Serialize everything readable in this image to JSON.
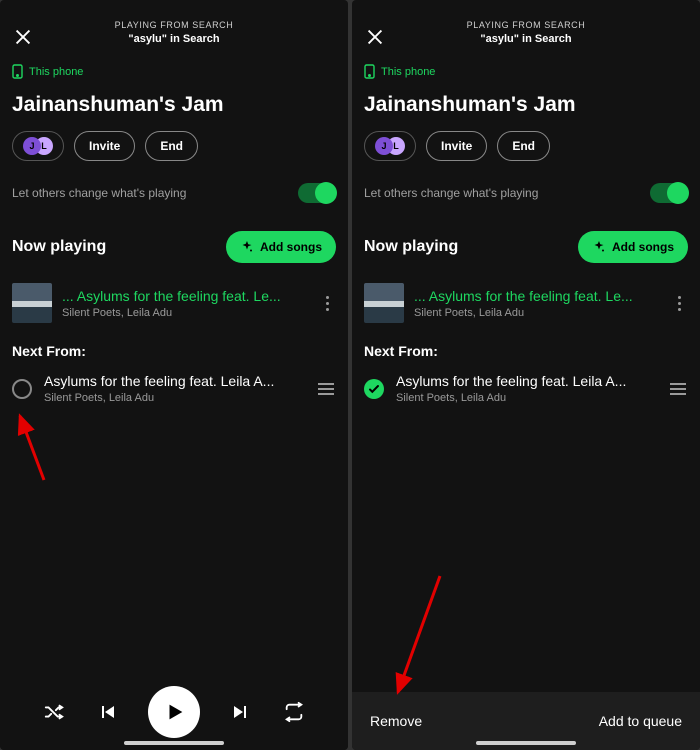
{
  "context_line1": "PLAYING FROM SEARCH",
  "context_line2": "\"asylu\" in Search",
  "device_label": "This phone",
  "session_title": "Jainanshuman's Jam",
  "invite_label": "Invite",
  "end_label": "End",
  "toggle_label": "Let others change what's playing",
  "now_playing_label": "Now playing",
  "add_songs_label": "Add songs",
  "now_track_title": "... Asylums for the feeling feat. Le...",
  "now_track_artist": "Silent Poets, Leila Adu",
  "next_label": "Next From:",
  "queue_track_title": "Asylums for the feeling feat. Leila A...",
  "queue_track_artist": "Silent Poets, Leila Adu",
  "remove_label": "Remove",
  "add_queue_label": "Add to queue",
  "avatar1": "J",
  "avatar2": "L"
}
